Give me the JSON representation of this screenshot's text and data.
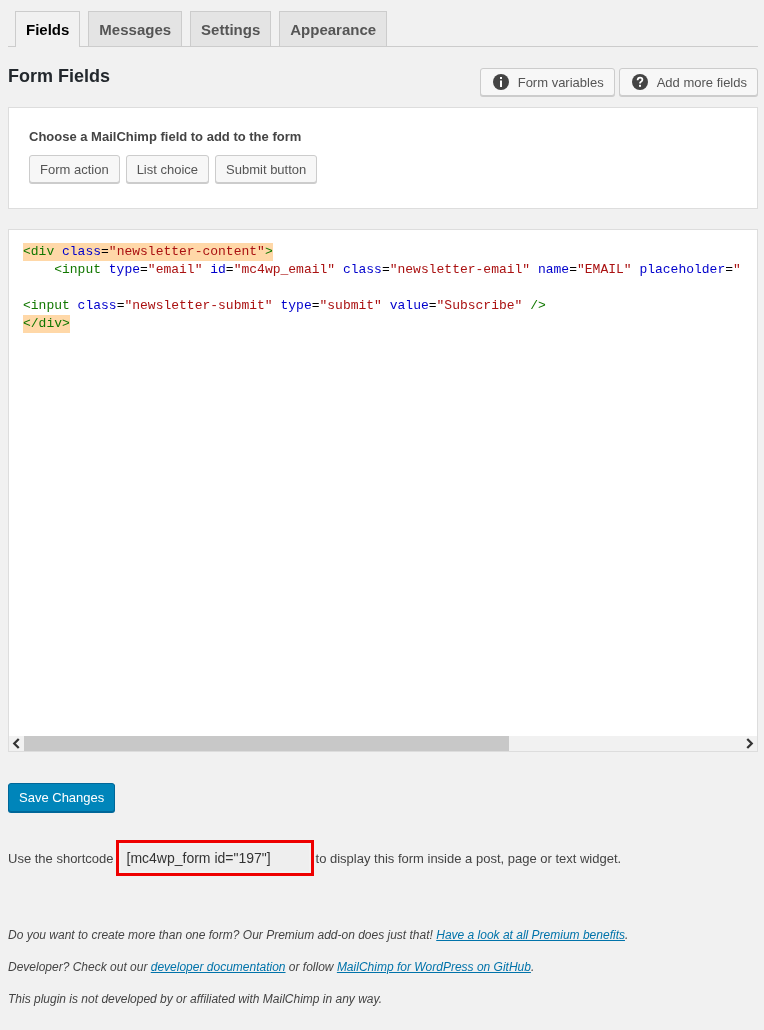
{
  "tabs": [
    {
      "label": "Fields",
      "selected": true
    },
    {
      "label": "Messages",
      "selected": false
    },
    {
      "label": "Settings",
      "selected": false
    },
    {
      "label": "Appearance",
      "selected": false
    }
  ],
  "heading": "Form Fields",
  "header_buttons": [
    {
      "label": "Form variables",
      "kind": "info"
    },
    {
      "label": "Add more fields",
      "kind": "help"
    }
  ],
  "field_panel": {
    "title": "Choose a MailChimp field to add to the form",
    "buttons": [
      "Form action",
      "List choice",
      "Submit button"
    ]
  },
  "code_editor": {
    "lines": [
      {
        "kind": "code",
        "matched": true,
        "tokens": [
          {
            "kind": "tag",
            "text": "<div"
          },
          {
            "kind": "attr",
            "text": " class"
          },
          {
            "kind": "plain",
            "text": "="
          },
          {
            "kind": "str",
            "text": "\"newsletter-content\""
          },
          {
            "kind": "tag",
            "text": ">"
          }
        ]
      },
      {
        "kind": "code",
        "matched": false,
        "tokens": [
          {
            "kind": "tag",
            "text": "    <input"
          },
          {
            "kind": "attr",
            "text": " type"
          },
          {
            "kind": "plain",
            "text": "="
          },
          {
            "kind": "str",
            "text": "\"email\""
          },
          {
            "kind": "attr",
            "text": " id"
          },
          {
            "kind": "plain",
            "text": "="
          },
          {
            "kind": "str",
            "text": "\"mc4wp_email\""
          },
          {
            "kind": "attr",
            "text": " class"
          },
          {
            "kind": "plain",
            "text": "="
          },
          {
            "kind": "str",
            "text": "\"newsletter-email\""
          },
          {
            "kind": "attr",
            "text": " name"
          },
          {
            "kind": "plain",
            "text": "="
          },
          {
            "kind": "str",
            "text": "\"EMAIL\""
          },
          {
            "kind": "attr",
            "text": " placeholder"
          },
          {
            "kind": "plain",
            "text": "="
          },
          {
            "kind": "str",
            "text": "\""
          }
        ]
      },
      {
        "kind": "blank"
      },
      {
        "kind": "code",
        "matched": false,
        "tokens": [
          {
            "kind": "tag",
            "text": "<input"
          },
          {
            "kind": "attr",
            "text": " class"
          },
          {
            "kind": "plain",
            "text": "="
          },
          {
            "kind": "str",
            "text": "\"newsletter-submit\""
          },
          {
            "kind": "attr",
            "text": " type"
          },
          {
            "kind": "plain",
            "text": "="
          },
          {
            "kind": "str",
            "text": "\"submit\""
          },
          {
            "kind": "attr",
            "text": " value"
          },
          {
            "kind": "plain",
            "text": "="
          },
          {
            "kind": "str",
            "text": "\"Subscribe\""
          },
          {
            "kind": "tag",
            "text": " />"
          }
        ]
      },
      {
        "kind": "code",
        "matched": true,
        "tokens": [
          {
            "kind": "tag",
            "text": "</div>"
          }
        ]
      }
    ]
  },
  "save_button": "Save Changes",
  "shortcode": {
    "before": "Use the shortcode",
    "value": "[mc4wp_form id=\"197\"]",
    "after": "to display this form inside a post, page or text widget.",
    "highlighted": true
  },
  "footer": [
    {
      "parts": [
        {
          "kind": "text",
          "text": "Do you want to create more than one form? Our Premium add-on does just that! "
        },
        {
          "kind": "link",
          "text": "Have a look at all Premium benefits"
        },
        {
          "kind": "text",
          "text": "."
        }
      ]
    },
    {
      "parts": [
        {
          "kind": "text",
          "text": "Developer? Check out our "
        },
        {
          "kind": "link",
          "text": "developer documentation"
        },
        {
          "kind": "text",
          "text": " or follow "
        },
        {
          "kind": "link",
          "text": "MailChimp for WordPress on GitHub"
        },
        {
          "kind": "text",
          "text": "."
        }
      ]
    },
    {
      "parts": [
        {
          "kind": "text",
          "text": "This plugin is not developed by or affiliated with MailChimp in any way."
        }
      ]
    }
  ]
}
